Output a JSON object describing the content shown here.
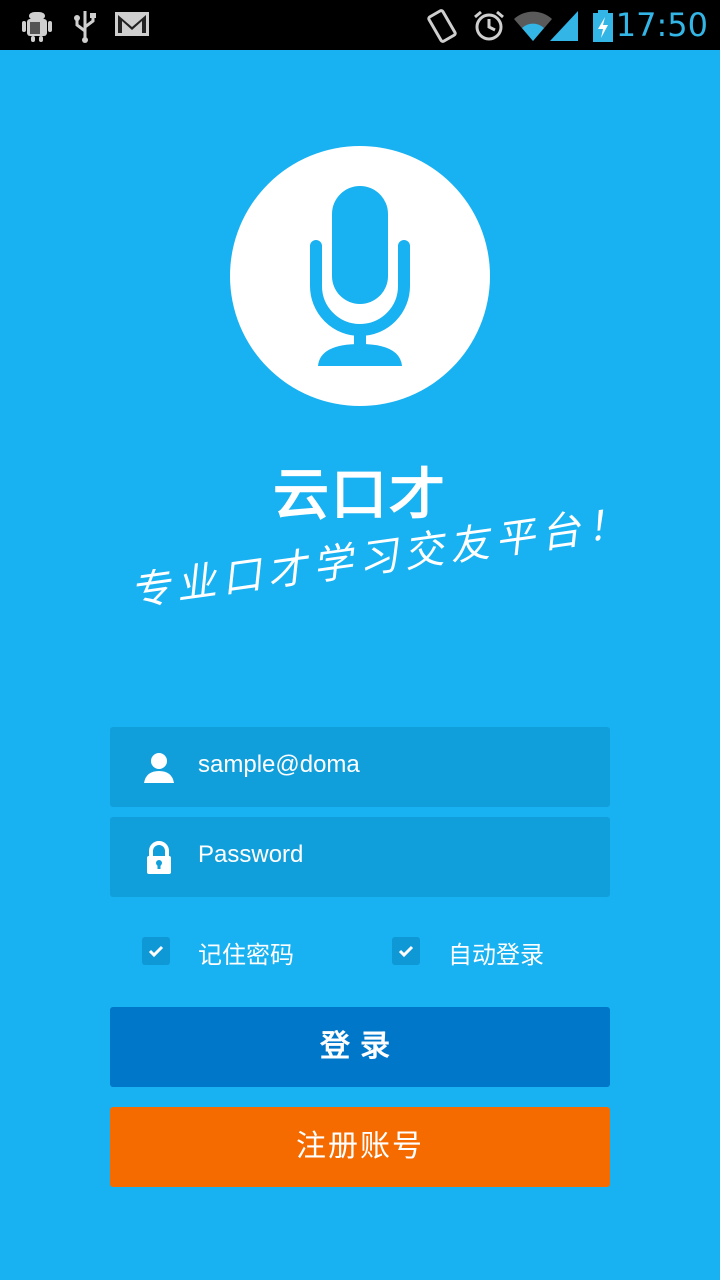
{
  "status_bar": {
    "time": "17:50",
    "icons": [
      "android-debug-icon",
      "usb-icon",
      "gmail-icon",
      "vibrate-icon",
      "alarm-icon",
      "wifi-icon",
      "signal-icon",
      "battery-charging-icon"
    ]
  },
  "app": {
    "logo_icon": "microphone-icon",
    "name": "云口才",
    "slogan": "专业口才学习交友平台！"
  },
  "form": {
    "username": {
      "value": "sample@doma",
      "icon": "user-icon"
    },
    "password": {
      "placeholder": "Password",
      "icon": "lock-icon"
    },
    "remember_password": {
      "label": "记住密码",
      "checked": true
    },
    "auto_login": {
      "label": "自动登录",
      "checked": true
    },
    "login_label": "登录",
    "register_label": "注册账号"
  },
  "colors": {
    "background": "#18b1f1",
    "field": "#119fdc",
    "login_button": "#0077c9",
    "register_button": "#f56b00"
  }
}
